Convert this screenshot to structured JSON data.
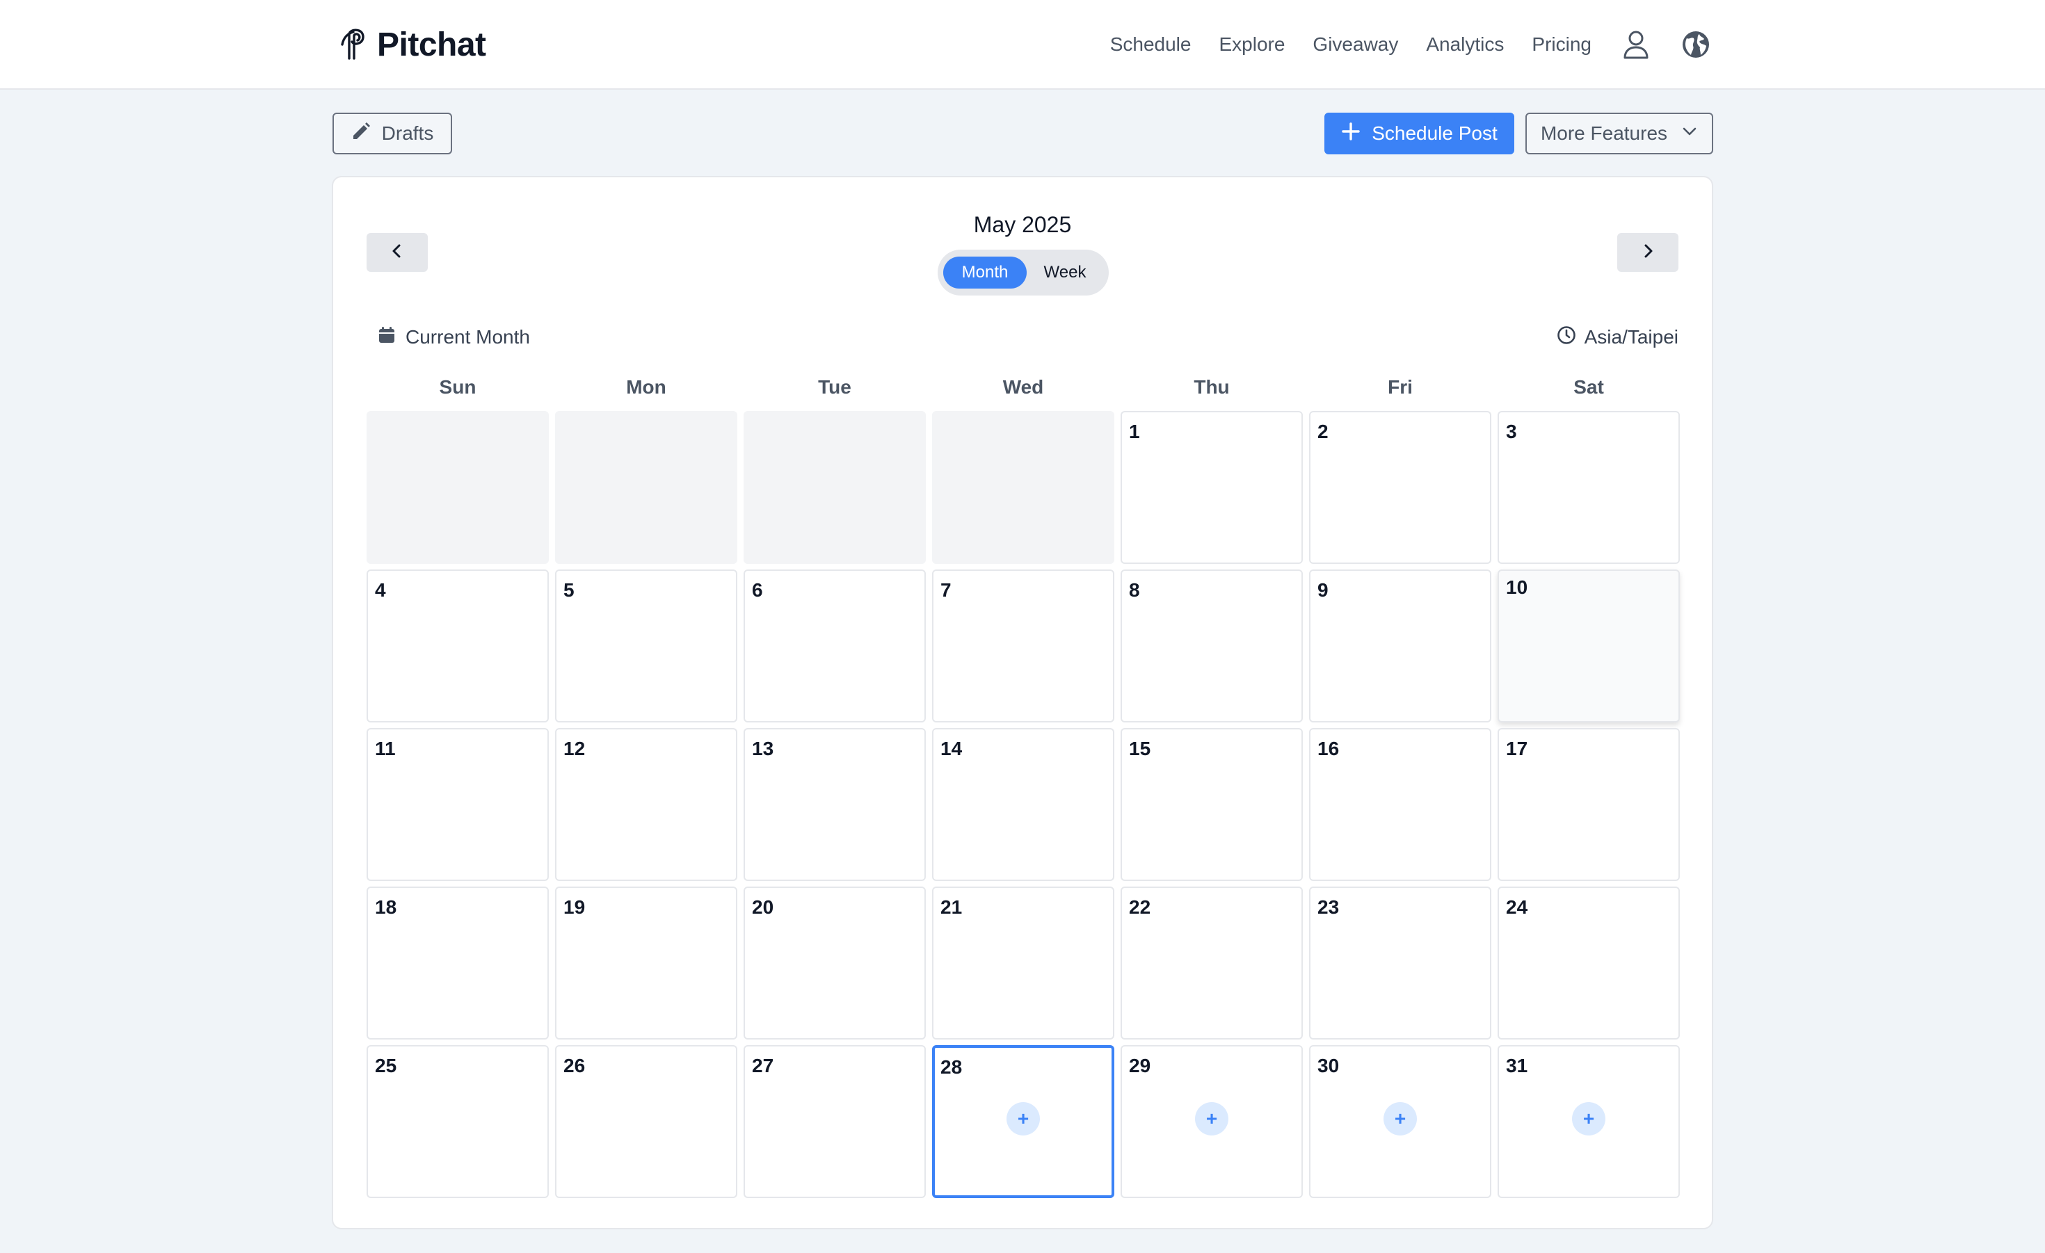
{
  "app": {
    "name": "Pitchat"
  },
  "nav": {
    "links": [
      "Schedule",
      "Explore",
      "Giveaway",
      "Analytics",
      "Pricing"
    ],
    "icons": [
      "user-icon",
      "globe-icon"
    ]
  },
  "toolbar": {
    "drafts_label": "Drafts",
    "schedule_label": "Schedule Post",
    "more_label": "More Features"
  },
  "calendar": {
    "title": "May 2025",
    "view_month": "Month",
    "view_week": "Week",
    "current_month_label": "Current Month",
    "timezone": "Asia/Taipei",
    "weekdays": [
      "Sun",
      "Mon",
      "Tue",
      "Wed",
      "Thu",
      "Fri",
      "Sat"
    ],
    "leading_blank_days": 4,
    "days_in_month": 31,
    "hovered_day": 10,
    "selected_day": 28,
    "days_with_add_button": [
      28,
      29,
      30,
      31
    ],
    "add_button_label": "+"
  },
  "colors": {
    "accent": "#3b82f6",
    "accent_light": "#dbeafe",
    "page_bg": "#f0f4f8",
    "empty_cell": "#f3f4f6"
  }
}
